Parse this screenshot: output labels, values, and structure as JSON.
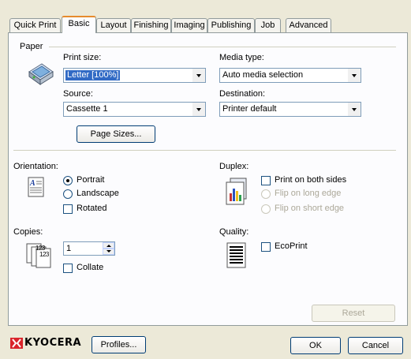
{
  "tabs": [
    "Quick Print",
    "Basic",
    "Layout",
    "Finishing",
    "Imaging",
    "Publishing",
    "Job",
    "Advanced"
  ],
  "active_tab": "Basic",
  "paper": {
    "group_label": "Paper",
    "print_size_label": "Print size:",
    "print_size_value": "Letter  [100%]",
    "source_label": "Source:",
    "source_value": "Cassette 1",
    "media_type_label": "Media type:",
    "media_type_value": "Auto media selection",
    "destination_label": "Destination:",
    "destination_value": "Printer default",
    "page_sizes_button": "Page Sizes..."
  },
  "orientation": {
    "label": "Orientation:",
    "portrait": "Portrait",
    "landscape": "Landscape",
    "rotated": "Rotated",
    "selected": "Portrait"
  },
  "duplex": {
    "label": "Duplex:",
    "print_both_sides": "Print on both sides",
    "flip_long": "Flip on long edge",
    "flip_short": "Flip on short edge"
  },
  "copies": {
    "label": "Copies:",
    "value": "1",
    "collate": "Collate",
    "icon_text": "123"
  },
  "quality": {
    "label": "Quality:",
    "ecoprint": "EcoPrint"
  },
  "buttons": {
    "reset": "Reset",
    "profiles": "Profiles...",
    "ok": "OK",
    "cancel": "Cancel"
  },
  "brand": {
    "name": "KYOCERA",
    "accent": "#d9242b"
  }
}
